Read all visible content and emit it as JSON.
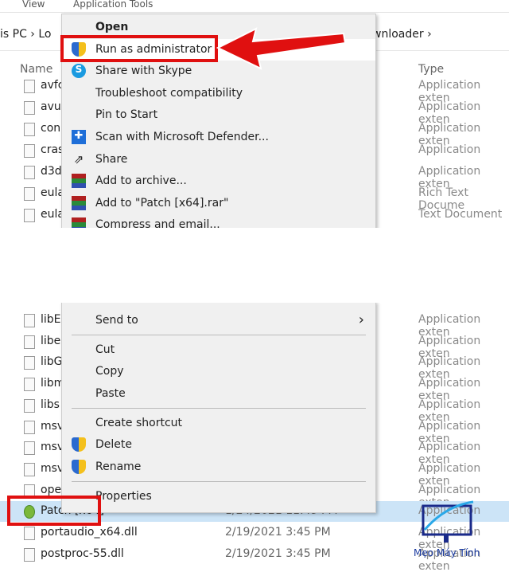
{
  "ribbon": {
    "tabs": [
      "View",
      "Application Tools"
    ]
  },
  "address": {
    "left": "is PC  ›  Lo",
    "right": "wnloader  ›"
  },
  "columns": {
    "name": "Name",
    "type": "Type"
  },
  "top_files": [
    {
      "name": "avfc",
      "type": "Application exten",
      "icon": "dll-file-icon"
    },
    {
      "name": "avut",
      "type": "Application exten",
      "icon": "dll-file-icon"
    },
    {
      "name": "con",
      "type": "Application exten",
      "icon": "dll-file-icon"
    },
    {
      "name": "cras",
      "type": "Application",
      "icon": "exe-icon"
    },
    {
      "name": "d3d",
      "type": "Application exten",
      "icon": "dll-file-icon"
    },
    {
      "name": "eula",
      "type": "Rich Text Docume",
      "icon": "rtf-icon"
    },
    {
      "name": "eula",
      "type": "Text Document",
      "icon": "txt-icon"
    }
  ],
  "top_menu": [
    {
      "label": "Open",
      "icon": ""
    },
    {
      "label": "Run as administrator",
      "icon": "uac-shield-icon"
    },
    {
      "label": "Share with Skype",
      "icon": "skype-icon"
    },
    {
      "label": "Troubleshoot compatibility",
      "icon": ""
    },
    {
      "label": "Pin to Start",
      "icon": ""
    },
    {
      "label": "Scan with Microsoft Defender...",
      "icon": "defender-icon"
    },
    {
      "label": "Share",
      "icon": "share-icon"
    },
    {
      "label": "Add to archive...",
      "icon": "winrar-icon"
    },
    {
      "label": "Add to \"Patch [x64].rar\"",
      "icon": "winrar-icon"
    },
    {
      "label": "Compress and email...",
      "icon": "winrar-icon"
    }
  ],
  "bottom_menu": {
    "send_to": "Send to",
    "cut": "Cut",
    "copy": "Copy",
    "paste": "Paste",
    "create_shortcut": "Create shortcut",
    "delete": "Delete",
    "rename": "Rename",
    "properties": "Properties"
  },
  "bottom_files": [
    {
      "name": "libE",
      "date": "",
      "type": "Application exten"
    },
    {
      "name": "libe",
      "date": "",
      "type": "Application exten"
    },
    {
      "name": "libG",
      "date": "",
      "type": "Application exten"
    },
    {
      "name": "libm",
      "date": "",
      "type": "Application exten"
    },
    {
      "name": "libs",
      "date": "",
      "type": "Application exten"
    },
    {
      "name": "msv",
      "date": "",
      "type": "Application exten"
    },
    {
      "name": "msv",
      "date": "",
      "type": "Application exten"
    },
    {
      "name": "msv",
      "date": "",
      "type": "Application exten"
    },
    {
      "name": "ope",
      "date": "",
      "type": "Application exten"
    },
    {
      "name": "Patch [x64]",
      "date": "1/24/2021 11:49 PM",
      "type": "Application",
      "selected": true
    },
    {
      "name": "portaudio_x64.dll",
      "date": "2/19/2021 3:45 PM",
      "type": "Application exten"
    },
    {
      "name": "postproc-55.dll",
      "date": "2/19/2021 3:45 PM",
      "type": "Application exten"
    }
  ],
  "watermark": "Mẹo Máy Tính",
  "colors": {
    "highlight": "#e01010",
    "selection": "#cce4f7",
    "menu_bg": "#f0f0f0"
  }
}
